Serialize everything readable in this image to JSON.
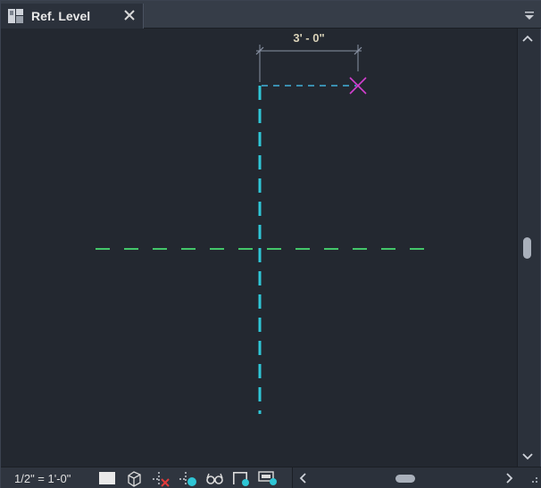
{
  "tab": {
    "title": "Ref. Level",
    "icon": "floor-plan-view-icon",
    "close_icon": "close-icon"
  },
  "tabstrip": {
    "menu_icon": "dropdown-menu-icon"
  },
  "drawing": {
    "dimension_text": "3' - 0\"",
    "colors": {
      "background": "#232830",
      "vertical_reference_line": "#2fc6d6",
      "horizontal_reference_line": "#43c66a",
      "dimension_line": "#8a93a5",
      "endpoint_marker": "#d43fd0",
      "temp_line": "#3a8fb0"
    }
  },
  "statusbar": {
    "scale": "1/2\" = 1'-0\"",
    "icons": [
      "detail-level-icon",
      "visual-style-cube-icon",
      "temporary-hide-isolate-icon",
      "reveal-hidden-elements-icon",
      "show-constraints-glasses-icon",
      "crop-region-icon",
      "highlight-displacement-icon"
    ]
  },
  "scrollbars": {
    "vertical": {
      "up": "chevron-up-icon",
      "down": "chevron-down-icon",
      "position": 0.5
    },
    "horizontal": {
      "left": "chevron-left-icon",
      "right": "chevron-right-icon",
      "position": 0.5
    }
  }
}
